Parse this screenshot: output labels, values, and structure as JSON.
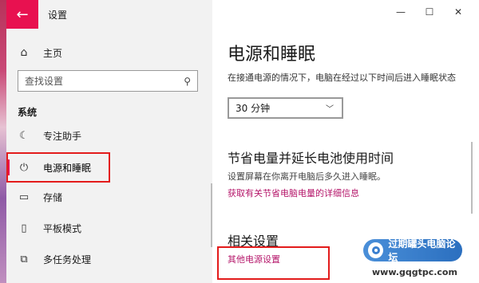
{
  "window": {
    "title": "设置"
  },
  "sidebar": {
    "home_label": "主页",
    "search_placeholder": "查找设置",
    "section_label": "系统",
    "items": [
      {
        "label": "专注助手",
        "icon": "moon-icon"
      },
      {
        "label": "电源和睡眠",
        "icon": "power-icon",
        "selected": true
      },
      {
        "label": "存储",
        "icon": "storage-icon"
      },
      {
        "label": "平板模式",
        "icon": "tablet-icon"
      },
      {
        "label": "多任务处理",
        "icon": "multitask-icon"
      }
    ]
  },
  "main": {
    "page_title": "电源和睡眠",
    "sleep_desc": "在接通电源的情况下，电脑在经过以下时间后进入睡眠状态",
    "sleep_value": "30 分钟",
    "battery_heading": "节省电量并延长电池使用时间",
    "battery_desc": "设置屏幕在你离开电脑后多久进入睡眠。",
    "battery_link": "获取有关节省电脑电量的详细信息",
    "related_heading": "相关设置",
    "related_link": "其他电源设置"
  },
  "watermark": {
    "text": "过期罐头电脑论坛",
    "url": "www.gqgtpc.com"
  },
  "colors": {
    "accent": "#e81150",
    "link": "#b5166a",
    "highlight_box": "#e31b1b"
  }
}
